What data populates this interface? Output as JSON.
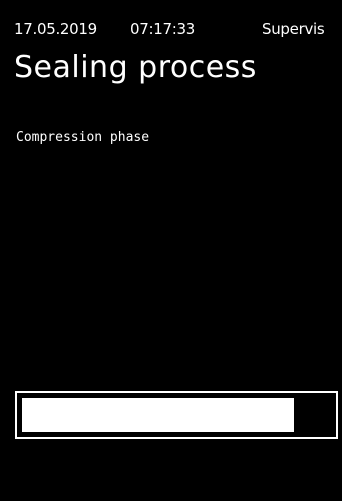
{
  "status": {
    "date": "17.05.2019",
    "time": "07:17:33",
    "user": "Supervis"
  },
  "title": "Sealing process",
  "phase": "Compression phase",
  "progress": {
    "fraction": 0.88,
    "fill_color": "#ffffff",
    "track_color": "#000000"
  }
}
